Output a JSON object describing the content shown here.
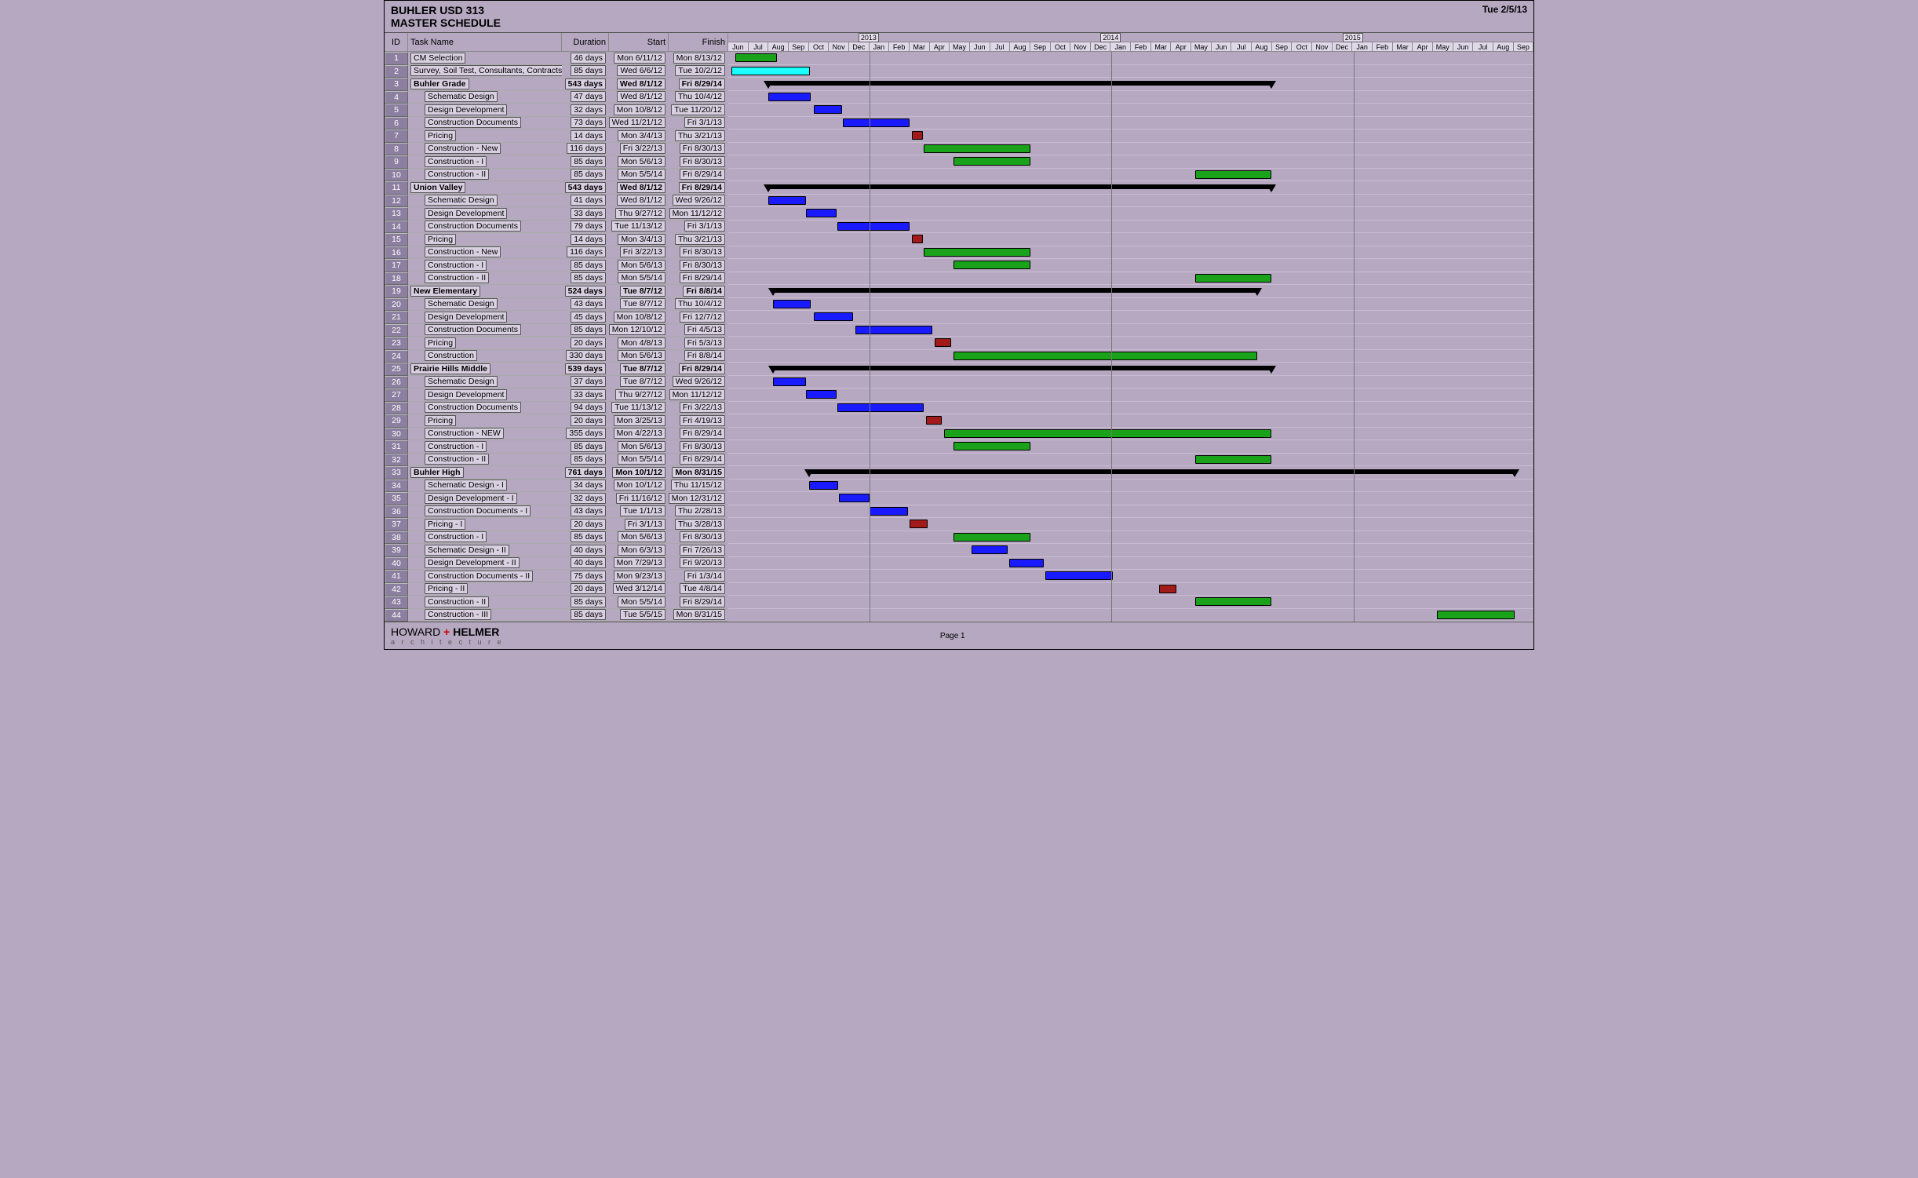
{
  "header": {
    "title1": "BUHLER USD 313",
    "title2": "MASTER SCHEDULE",
    "date": "Tue 2/5/13"
  },
  "columns": {
    "id": "ID",
    "name": "Task Name",
    "duration": "Duration",
    "start": "Start",
    "finish": "Finish"
  },
  "footer": {
    "logo1": "HOWARD",
    "plus": "+",
    "logo2": "HELMER",
    "arch": "a r c h i t e c t u r e",
    "page": "Page 1"
  },
  "timeline": {
    "start_month_index": 5,
    "months": [
      "Jun",
      "Jul",
      "Aug",
      "Sep",
      "Oct",
      "Nov",
      "Dec",
      "Jan",
      "Feb",
      "Mar",
      "Apr",
      "May",
      "Jun",
      "Jul",
      "Aug",
      "Sep",
      "Oct",
      "Nov",
      "Dec",
      "Jan",
      "Feb",
      "Mar",
      "Apr",
      "May",
      "Jun",
      "Jul",
      "Aug",
      "Sep",
      "Oct",
      "Nov",
      "Dec",
      "Jan",
      "Feb",
      "Mar",
      "Apr",
      "May",
      "Jun",
      "Jul",
      "Aug",
      "Sep"
    ],
    "years": [
      {
        "label": "2013",
        "month_index": 7
      },
      {
        "label": "2014",
        "month_index": 19
      },
      {
        "label": "2015",
        "month_index": 31
      }
    ]
  },
  "chart_data": {
    "type": "gantt",
    "title": "BUHLER USD 313 MASTER SCHEDULE",
    "date_generated": "Tue 2/5/13",
    "timeline_range": [
      "2012-06",
      "2015-09"
    ],
    "columns": [
      "ID",
      "Task Name",
      "Duration",
      "Start",
      "Finish"
    ],
    "tasks": [
      {
        "id": 1,
        "name": "CM Selection",
        "duration": "46 days",
        "start": "Mon 6/11/12",
        "finish": "Mon 8/13/12",
        "type": "task",
        "color": "green",
        "indent": 0
      },
      {
        "id": 2,
        "name": "Survey, Soil Test, Consultants, Contracts",
        "duration": "85 days",
        "start": "Wed 6/6/12",
        "finish": "Tue 10/2/12",
        "type": "task",
        "color": "cyan",
        "indent": 0
      },
      {
        "id": 3,
        "name": "Buhler Grade",
        "duration": "543 days",
        "start": "Wed 8/1/12",
        "finish": "Fri 8/29/14",
        "type": "summary",
        "indent": 0
      },
      {
        "id": 4,
        "name": "Schematic Design",
        "duration": "47 days",
        "start": "Wed 8/1/12",
        "finish": "Thu 10/4/12",
        "type": "task",
        "color": "blue",
        "indent": 1
      },
      {
        "id": 5,
        "name": "Design Development",
        "duration": "32 days",
        "start": "Mon 10/8/12",
        "finish": "Tue 11/20/12",
        "type": "task",
        "color": "blue",
        "indent": 1
      },
      {
        "id": 6,
        "name": "Construction Documents",
        "duration": "73 days",
        "start": "Wed 11/21/12",
        "finish": "Fri 3/1/13",
        "type": "task",
        "color": "blue",
        "indent": 1
      },
      {
        "id": 7,
        "name": "Pricing",
        "duration": "14 days",
        "start": "Mon 3/4/13",
        "finish": "Thu 3/21/13",
        "type": "task",
        "color": "red",
        "indent": 1
      },
      {
        "id": 8,
        "name": "Construction - New",
        "duration": "116 days",
        "start": "Fri 3/22/13",
        "finish": "Fri 8/30/13",
        "type": "task",
        "color": "green",
        "indent": 1
      },
      {
        "id": 9,
        "name": "Construction - I",
        "duration": "85 days",
        "start": "Mon 5/6/13",
        "finish": "Fri 8/30/13",
        "type": "task",
        "color": "green",
        "indent": 1
      },
      {
        "id": 10,
        "name": "Construction - II",
        "duration": "85 days",
        "start": "Mon 5/5/14",
        "finish": "Fri 8/29/14",
        "type": "task",
        "color": "green",
        "indent": 1
      },
      {
        "id": 11,
        "name": "Union Valley",
        "duration": "543 days",
        "start": "Wed 8/1/12",
        "finish": "Fri 8/29/14",
        "type": "summary",
        "indent": 0
      },
      {
        "id": 12,
        "name": "Schematic Design",
        "duration": "41 days",
        "start": "Wed 8/1/12",
        "finish": "Wed 9/26/12",
        "type": "task",
        "color": "blue",
        "indent": 1
      },
      {
        "id": 13,
        "name": "Design Development",
        "duration": "33 days",
        "start": "Thu 9/27/12",
        "finish": "Mon 11/12/12",
        "type": "task",
        "color": "blue",
        "indent": 1
      },
      {
        "id": 14,
        "name": "Construction Documents",
        "duration": "79 days",
        "start": "Tue 11/13/12",
        "finish": "Fri 3/1/13",
        "type": "task",
        "color": "blue",
        "indent": 1
      },
      {
        "id": 15,
        "name": "Pricing",
        "duration": "14 days",
        "start": "Mon 3/4/13",
        "finish": "Thu 3/21/13",
        "type": "task",
        "color": "red",
        "indent": 1
      },
      {
        "id": 16,
        "name": "Construction - New",
        "duration": "116 days",
        "start": "Fri 3/22/13",
        "finish": "Fri 8/30/13",
        "type": "task",
        "color": "green",
        "indent": 1
      },
      {
        "id": 17,
        "name": "Construction - I",
        "duration": "85 days",
        "start": "Mon 5/6/13",
        "finish": "Fri 8/30/13",
        "type": "task",
        "color": "green",
        "indent": 1
      },
      {
        "id": 18,
        "name": "Construction - II",
        "duration": "85 days",
        "start": "Mon 5/5/14",
        "finish": "Fri 8/29/14",
        "type": "task",
        "color": "green",
        "indent": 1
      },
      {
        "id": 19,
        "name": "New Elementary",
        "duration": "524 days",
        "start": "Tue 8/7/12",
        "finish": "Fri 8/8/14",
        "type": "summary",
        "indent": 0
      },
      {
        "id": 20,
        "name": "Schematic Design",
        "duration": "43 days",
        "start": "Tue 8/7/12",
        "finish": "Thu 10/4/12",
        "type": "task",
        "color": "blue",
        "indent": 1
      },
      {
        "id": 21,
        "name": "Design Development",
        "duration": "45 days",
        "start": "Mon 10/8/12",
        "finish": "Fri 12/7/12",
        "type": "task",
        "color": "blue",
        "indent": 1
      },
      {
        "id": 22,
        "name": "Construction Documents",
        "duration": "85 days",
        "start": "Mon 12/10/12",
        "finish": "Fri 4/5/13",
        "type": "task",
        "color": "blue",
        "indent": 1
      },
      {
        "id": 23,
        "name": "Pricing",
        "duration": "20 days",
        "start": "Mon 4/8/13",
        "finish": "Fri 5/3/13",
        "type": "task",
        "color": "red",
        "indent": 1
      },
      {
        "id": 24,
        "name": "Construction",
        "duration": "330 days",
        "start": "Mon 5/6/13",
        "finish": "Fri 8/8/14",
        "type": "task",
        "color": "green",
        "indent": 1
      },
      {
        "id": 25,
        "name": "Prairie Hills Middle",
        "duration": "539 days",
        "start": "Tue 8/7/12",
        "finish": "Fri 8/29/14",
        "type": "summary",
        "indent": 0
      },
      {
        "id": 26,
        "name": "Schematic Design",
        "duration": "37 days",
        "start": "Tue 8/7/12",
        "finish": "Wed 9/26/12",
        "type": "task",
        "color": "blue",
        "indent": 1
      },
      {
        "id": 27,
        "name": "Design Development",
        "duration": "33 days",
        "start": "Thu 9/27/12",
        "finish": "Mon 11/12/12",
        "type": "task",
        "color": "blue",
        "indent": 1
      },
      {
        "id": 28,
        "name": "Construction Documents",
        "duration": "94 days",
        "start": "Tue 11/13/12",
        "finish": "Fri 3/22/13",
        "type": "task",
        "color": "blue",
        "indent": 1
      },
      {
        "id": 29,
        "name": "Pricing",
        "duration": "20 days",
        "start": "Mon 3/25/13",
        "finish": "Fri 4/19/13",
        "type": "task",
        "color": "red",
        "indent": 1
      },
      {
        "id": 30,
        "name": "Construction - NEW",
        "duration": "355 days",
        "start": "Mon 4/22/13",
        "finish": "Fri 8/29/14",
        "type": "task",
        "color": "green",
        "indent": 1
      },
      {
        "id": 31,
        "name": "Construction - I",
        "duration": "85 days",
        "start": "Mon 5/6/13",
        "finish": "Fri 8/30/13",
        "type": "task",
        "color": "green",
        "indent": 1
      },
      {
        "id": 32,
        "name": "Construction - II",
        "duration": "85 days",
        "start": "Mon 5/5/14",
        "finish": "Fri 8/29/14",
        "type": "task",
        "color": "green",
        "indent": 1
      },
      {
        "id": 33,
        "name": "Buhler High",
        "duration": "761 days",
        "start": "Mon 10/1/12",
        "finish": "Mon 8/31/15",
        "type": "summary",
        "indent": 0
      },
      {
        "id": 34,
        "name": "Schematic Design - I",
        "duration": "34 days",
        "start": "Mon 10/1/12",
        "finish": "Thu 11/15/12",
        "type": "task",
        "color": "blue",
        "indent": 1
      },
      {
        "id": 35,
        "name": "Design Development - I",
        "duration": "32 days",
        "start": "Fri 11/16/12",
        "finish": "Mon 12/31/12",
        "type": "task",
        "color": "blue",
        "indent": 1
      },
      {
        "id": 36,
        "name": "Construction Documents - I",
        "duration": "43 days",
        "start": "Tue 1/1/13",
        "finish": "Thu 2/28/13",
        "type": "task",
        "color": "blue",
        "indent": 1
      },
      {
        "id": 37,
        "name": "Pricing - I",
        "duration": "20 days",
        "start": "Fri 3/1/13",
        "finish": "Thu 3/28/13",
        "type": "task",
        "color": "red",
        "indent": 1
      },
      {
        "id": 38,
        "name": "Construction - I",
        "duration": "85 days",
        "start": "Mon 5/6/13",
        "finish": "Fri 8/30/13",
        "type": "task",
        "color": "green",
        "indent": 1
      },
      {
        "id": 39,
        "name": "Schematic Design - II",
        "duration": "40 days",
        "start": "Mon 6/3/13",
        "finish": "Fri 7/26/13",
        "type": "task",
        "color": "blue",
        "indent": 1
      },
      {
        "id": 40,
        "name": "Design Development - II",
        "duration": "40 days",
        "start": "Mon 7/29/13",
        "finish": "Fri 9/20/13",
        "type": "task",
        "color": "blue",
        "indent": 1
      },
      {
        "id": 41,
        "name": "Construction Documents - II",
        "duration": "75 days",
        "start": "Mon 9/23/13",
        "finish": "Fri 1/3/14",
        "type": "task",
        "color": "blue",
        "indent": 1
      },
      {
        "id": 42,
        "name": "Pricing - II",
        "duration": "20 days",
        "start": "Wed 3/12/14",
        "finish": "Tue 4/8/14",
        "type": "task",
        "color": "red",
        "indent": 1
      },
      {
        "id": 43,
        "name": "Construction - II",
        "duration": "85 days",
        "start": "Mon 5/5/14",
        "finish": "Fri 8/29/14",
        "type": "task",
        "color": "green",
        "indent": 1
      },
      {
        "id": 44,
        "name": "Construction - III",
        "duration": "85 days",
        "start": "Tue 5/5/15",
        "finish": "Mon 8/31/15",
        "type": "task",
        "color": "green",
        "indent": 1
      }
    ]
  }
}
